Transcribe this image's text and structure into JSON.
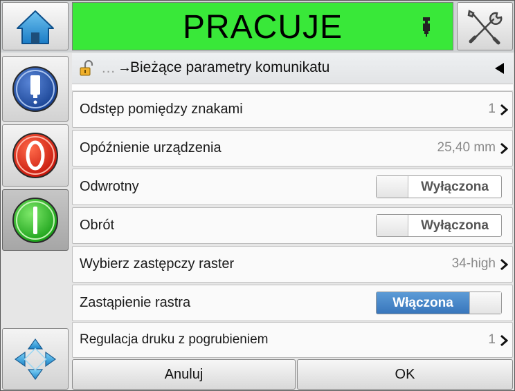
{
  "status": {
    "text": "PRACUJE",
    "color": "#39e839"
  },
  "icons": {
    "home": "home-icon",
    "tools": "tools-icon",
    "ink": "ink-cartridge-icon",
    "printer_status": "printer-status-icon",
    "stop": "stop-icon",
    "start": "start-icon",
    "navigate": "navigation-arrows-icon",
    "lock": "lock-icon",
    "back": "back-arrow-icon"
  },
  "breadcrumb": {
    "ellipsis": "…",
    "arrow": "→",
    "title": "Bieżące parametry komunikatu"
  },
  "rows": [
    {
      "label": "Odstęp pomiędzy znakami",
      "value": "1",
      "type": "value"
    },
    {
      "label": "Opóźnienie urządzenia",
      "value": "25,40 mm",
      "type": "value"
    },
    {
      "label": "Odwrotny",
      "value": "Wyłączona",
      "type": "toggle",
      "on": false
    },
    {
      "label": "Obrót",
      "value": "Wyłączona",
      "type": "toggle",
      "on": false
    },
    {
      "label": "Wybierz zastępczy raster",
      "value": "34-high",
      "type": "value"
    },
    {
      "label": "Zastąpienie rastra",
      "value": "Włączona",
      "type": "toggle",
      "on": true
    },
    {
      "label": "Regulacja druku z pogrubieniem",
      "value": "1",
      "type": "value"
    }
  ],
  "buttons": {
    "cancel": "Anuluj",
    "ok": "OK"
  },
  "colors": {
    "toggle_on": "#3a7abf",
    "stop": "#e01e10",
    "start": "#23b81e",
    "info": "#1f4fa8"
  }
}
